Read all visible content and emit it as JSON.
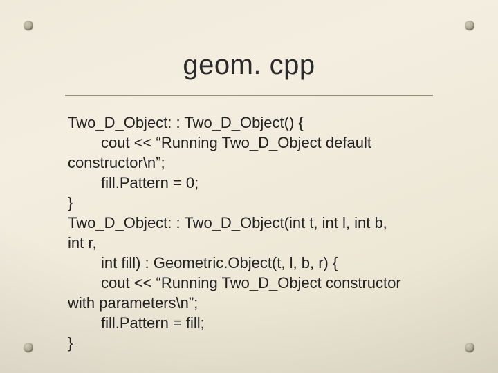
{
  "title": "geom. cpp",
  "code": {
    "l1": "Two_D_Object: : Two_D_Object() {",
    "l2": "cout << “Running Two_D_Object default",
    "l3": "constructor\\n”;",
    "l4": "fill.Pattern = 0;",
    "l5": "}",
    "l6": "Two_D_Object: : Two_D_Object(int t, int l, int b,",
    "l7": "int r,",
    "l8": "int fill) : Geometric.Object(t, l, b, r) {",
    "l9": "cout << “Running Two_D_Object constructor",
    "l10": "with parameters\\n”;",
    "l11": "fill.Pattern = fill;",
    "l12": "}"
  }
}
